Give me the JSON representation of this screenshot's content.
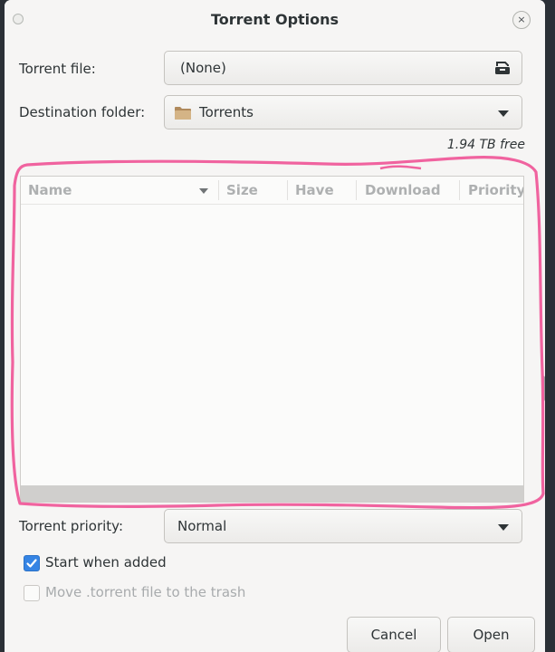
{
  "window": {
    "title": "Torrent Options",
    "close_glyph": "×"
  },
  "form": {
    "torrent_file_label": "Torrent file:",
    "torrent_file_value": "(None)",
    "destination_label": "Destination folder:",
    "destination_value": "Torrents",
    "free_space": "1.94 TB free"
  },
  "file_list": {
    "columns": [
      "Name",
      "Size",
      "Have",
      "Download",
      "Priority"
    ],
    "sort_column": "Name",
    "rows": []
  },
  "priority": {
    "label": "Torrent priority:",
    "value": "Normal"
  },
  "options": {
    "start_when_added_label": "Start when added",
    "start_when_added_checked": true,
    "move_to_trash_label": "Move .torrent file to the trash",
    "move_to_trash_checked": false,
    "move_to_trash_enabled": false
  },
  "buttons": {
    "cancel": "Cancel",
    "open": "Open"
  },
  "icons": {
    "file_chooser": "document-open-icon",
    "folder": "folder-icon",
    "dropdown": "chevron-down-icon"
  },
  "colors": {
    "accent": "#3584e4",
    "annotation": "#f0639f",
    "dialog_bg": "#f6f5f4"
  }
}
